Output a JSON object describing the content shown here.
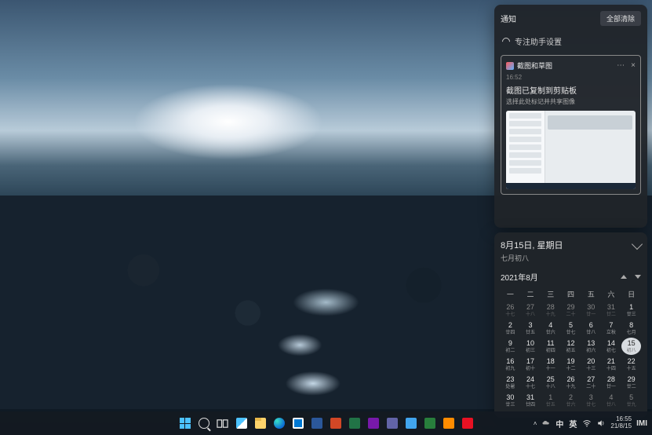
{
  "notif": {
    "title": "通知",
    "clear_all": "全部清除",
    "focus_assist": "专注助手设置",
    "card": {
      "app_name": "截图和草图",
      "more": "⋯",
      "close": "×",
      "time": "16:52",
      "title": "截图已复制到剪贴板",
      "subtitle": "选择此处标记并共享图像"
    }
  },
  "calendar": {
    "date_line1": "8月15日, 星期日",
    "date_line2": "七月初八",
    "month_label": "2021年8月",
    "weekdays": [
      "一",
      "二",
      "三",
      "四",
      "五",
      "六",
      "日"
    ],
    "rows": [
      [
        {
          "n": "26",
          "l": "十七",
          "m": false
        },
        {
          "n": "27",
          "l": "十八",
          "m": false
        },
        {
          "n": "28",
          "l": "十九",
          "m": false
        },
        {
          "n": "29",
          "l": "二十",
          "m": false
        },
        {
          "n": "30",
          "l": "廿一",
          "m": false
        },
        {
          "n": "31",
          "l": "廿二",
          "m": false
        },
        {
          "n": "1",
          "l": "廿三",
          "m": true
        }
      ],
      [
        {
          "n": "2",
          "l": "廿四",
          "m": true
        },
        {
          "n": "3",
          "l": "廿五",
          "m": true
        },
        {
          "n": "4",
          "l": "廿六",
          "m": true
        },
        {
          "n": "5",
          "l": "廿七",
          "m": true
        },
        {
          "n": "6",
          "l": "廿八",
          "m": true
        },
        {
          "n": "7",
          "l": "立秋",
          "m": true
        },
        {
          "n": "8",
          "l": "七月",
          "m": true
        }
      ],
      [
        {
          "n": "9",
          "l": "初二",
          "m": true
        },
        {
          "n": "10",
          "l": "初三",
          "m": true
        },
        {
          "n": "11",
          "l": "初四",
          "m": true
        },
        {
          "n": "12",
          "l": "初五",
          "m": true
        },
        {
          "n": "13",
          "l": "初六",
          "m": true
        },
        {
          "n": "14",
          "l": "初七",
          "m": true
        },
        {
          "n": "15",
          "l": "初八",
          "m": true,
          "sel": true
        }
      ],
      [
        {
          "n": "16",
          "l": "初九",
          "m": true
        },
        {
          "n": "17",
          "l": "初十",
          "m": true
        },
        {
          "n": "18",
          "l": "十一",
          "m": true
        },
        {
          "n": "19",
          "l": "十二",
          "m": true
        },
        {
          "n": "20",
          "l": "十三",
          "m": true
        },
        {
          "n": "21",
          "l": "十四",
          "m": true
        },
        {
          "n": "22",
          "l": "十五",
          "m": true
        }
      ],
      [
        {
          "n": "23",
          "l": "处暑",
          "m": true
        },
        {
          "n": "24",
          "l": "十七",
          "m": true
        },
        {
          "n": "25",
          "l": "十八",
          "m": true
        },
        {
          "n": "26",
          "l": "十九",
          "m": true
        },
        {
          "n": "27",
          "l": "二十",
          "m": true
        },
        {
          "n": "28",
          "l": "廿一",
          "m": true
        },
        {
          "n": "29",
          "l": "廿二",
          "m": true
        }
      ],
      [
        {
          "n": "30",
          "l": "廿三",
          "m": true
        },
        {
          "n": "31",
          "l": "廿四",
          "m": true
        },
        {
          "n": "1",
          "l": "廿五",
          "m": false
        },
        {
          "n": "2",
          "l": "廿六",
          "m": false
        },
        {
          "n": "3",
          "l": "廿七",
          "m": false
        },
        {
          "n": "4",
          "l": "廿八",
          "m": false
        },
        {
          "n": "5",
          "l": "廿九",
          "m": false
        }
      ]
    ]
  },
  "taskbar": {
    "tray": {
      "ime_mode": "中",
      "ime_lang": "英"
    },
    "clock": {
      "time": "16:55",
      "date": "21/8/15"
    },
    "imi": "IMI"
  }
}
